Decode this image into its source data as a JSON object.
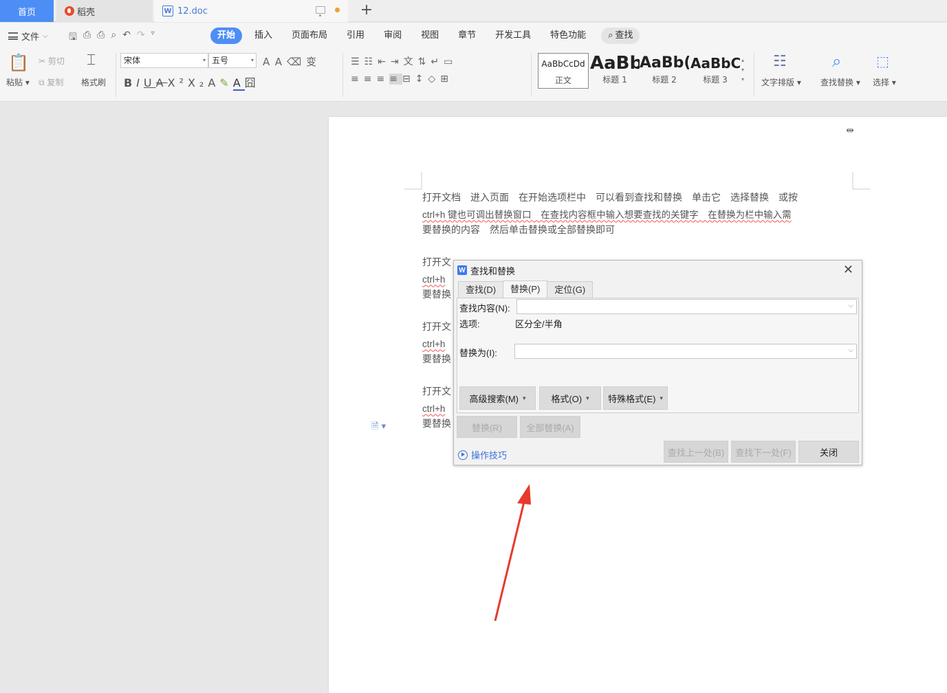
{
  "tabs": {
    "home": "首页",
    "daoke": "稻壳",
    "doc": "12.doc",
    "new_tab": "+"
  },
  "menu": {
    "file": "文件",
    "items": [
      "开始",
      "插入",
      "页面布局",
      "引用",
      "审阅",
      "视图",
      "章节",
      "开发工具",
      "特色功能"
    ],
    "search": "查找"
  },
  "ribbon": {
    "paste": "粘贴",
    "cut": "剪切",
    "copy": "复制",
    "format_painter": "格式刷",
    "font_name": "宋体",
    "font_size": "五号",
    "styles": [
      {
        "sample": "AaBbCcDd",
        "name": "正文"
      },
      {
        "sample": "AaBb",
        "name": "标题 1"
      },
      {
        "sample": "AaBb(",
        "name": "标题 2"
      },
      {
        "sample": "AaBbC(",
        "name": "标题 3"
      }
    ],
    "text_layout": "文字排版",
    "find_replace": "查找替换",
    "select": "选择"
  },
  "document": {
    "paragraph1": [
      "打开文档　进入页面　在开始选项栏中　可以看到查找和替换　单击它　选择替换　或按",
      "ctrl+h 键也可调出替换窗口　在查找内容框中输入想要查找的关键字　在替换为栏中输入需",
      "要替换的内容　然后单击替换或全部替换即可"
    ],
    "partial_lines": [
      "打开文",
      "ctrl+h",
      "要替换"
    ]
  },
  "dialog": {
    "title": "查找和替换",
    "tabs": [
      "查找(D)",
      "替换(P)",
      "定位(G)"
    ],
    "active_tab": "替换(P)",
    "find_label": "查找内容(N):",
    "find_value": "",
    "options_label": "选项:",
    "options_value": "区分全/半角",
    "replace_label": "替换为(I):",
    "replace_value": "",
    "advanced_search": "高级搜索(M)",
    "format": "格式(O)",
    "special_format": "特殊格式(E)",
    "replace_btn": "替换(R)",
    "replace_all_btn": "全部替换(A)",
    "tips": "操作技巧",
    "find_prev": "查找上一处(B)",
    "find_next": "查找下一处(F)",
    "close": "关闭"
  },
  "colors": {
    "accent": "#4d8ef6",
    "annotation_arrow": "#e8392c"
  }
}
